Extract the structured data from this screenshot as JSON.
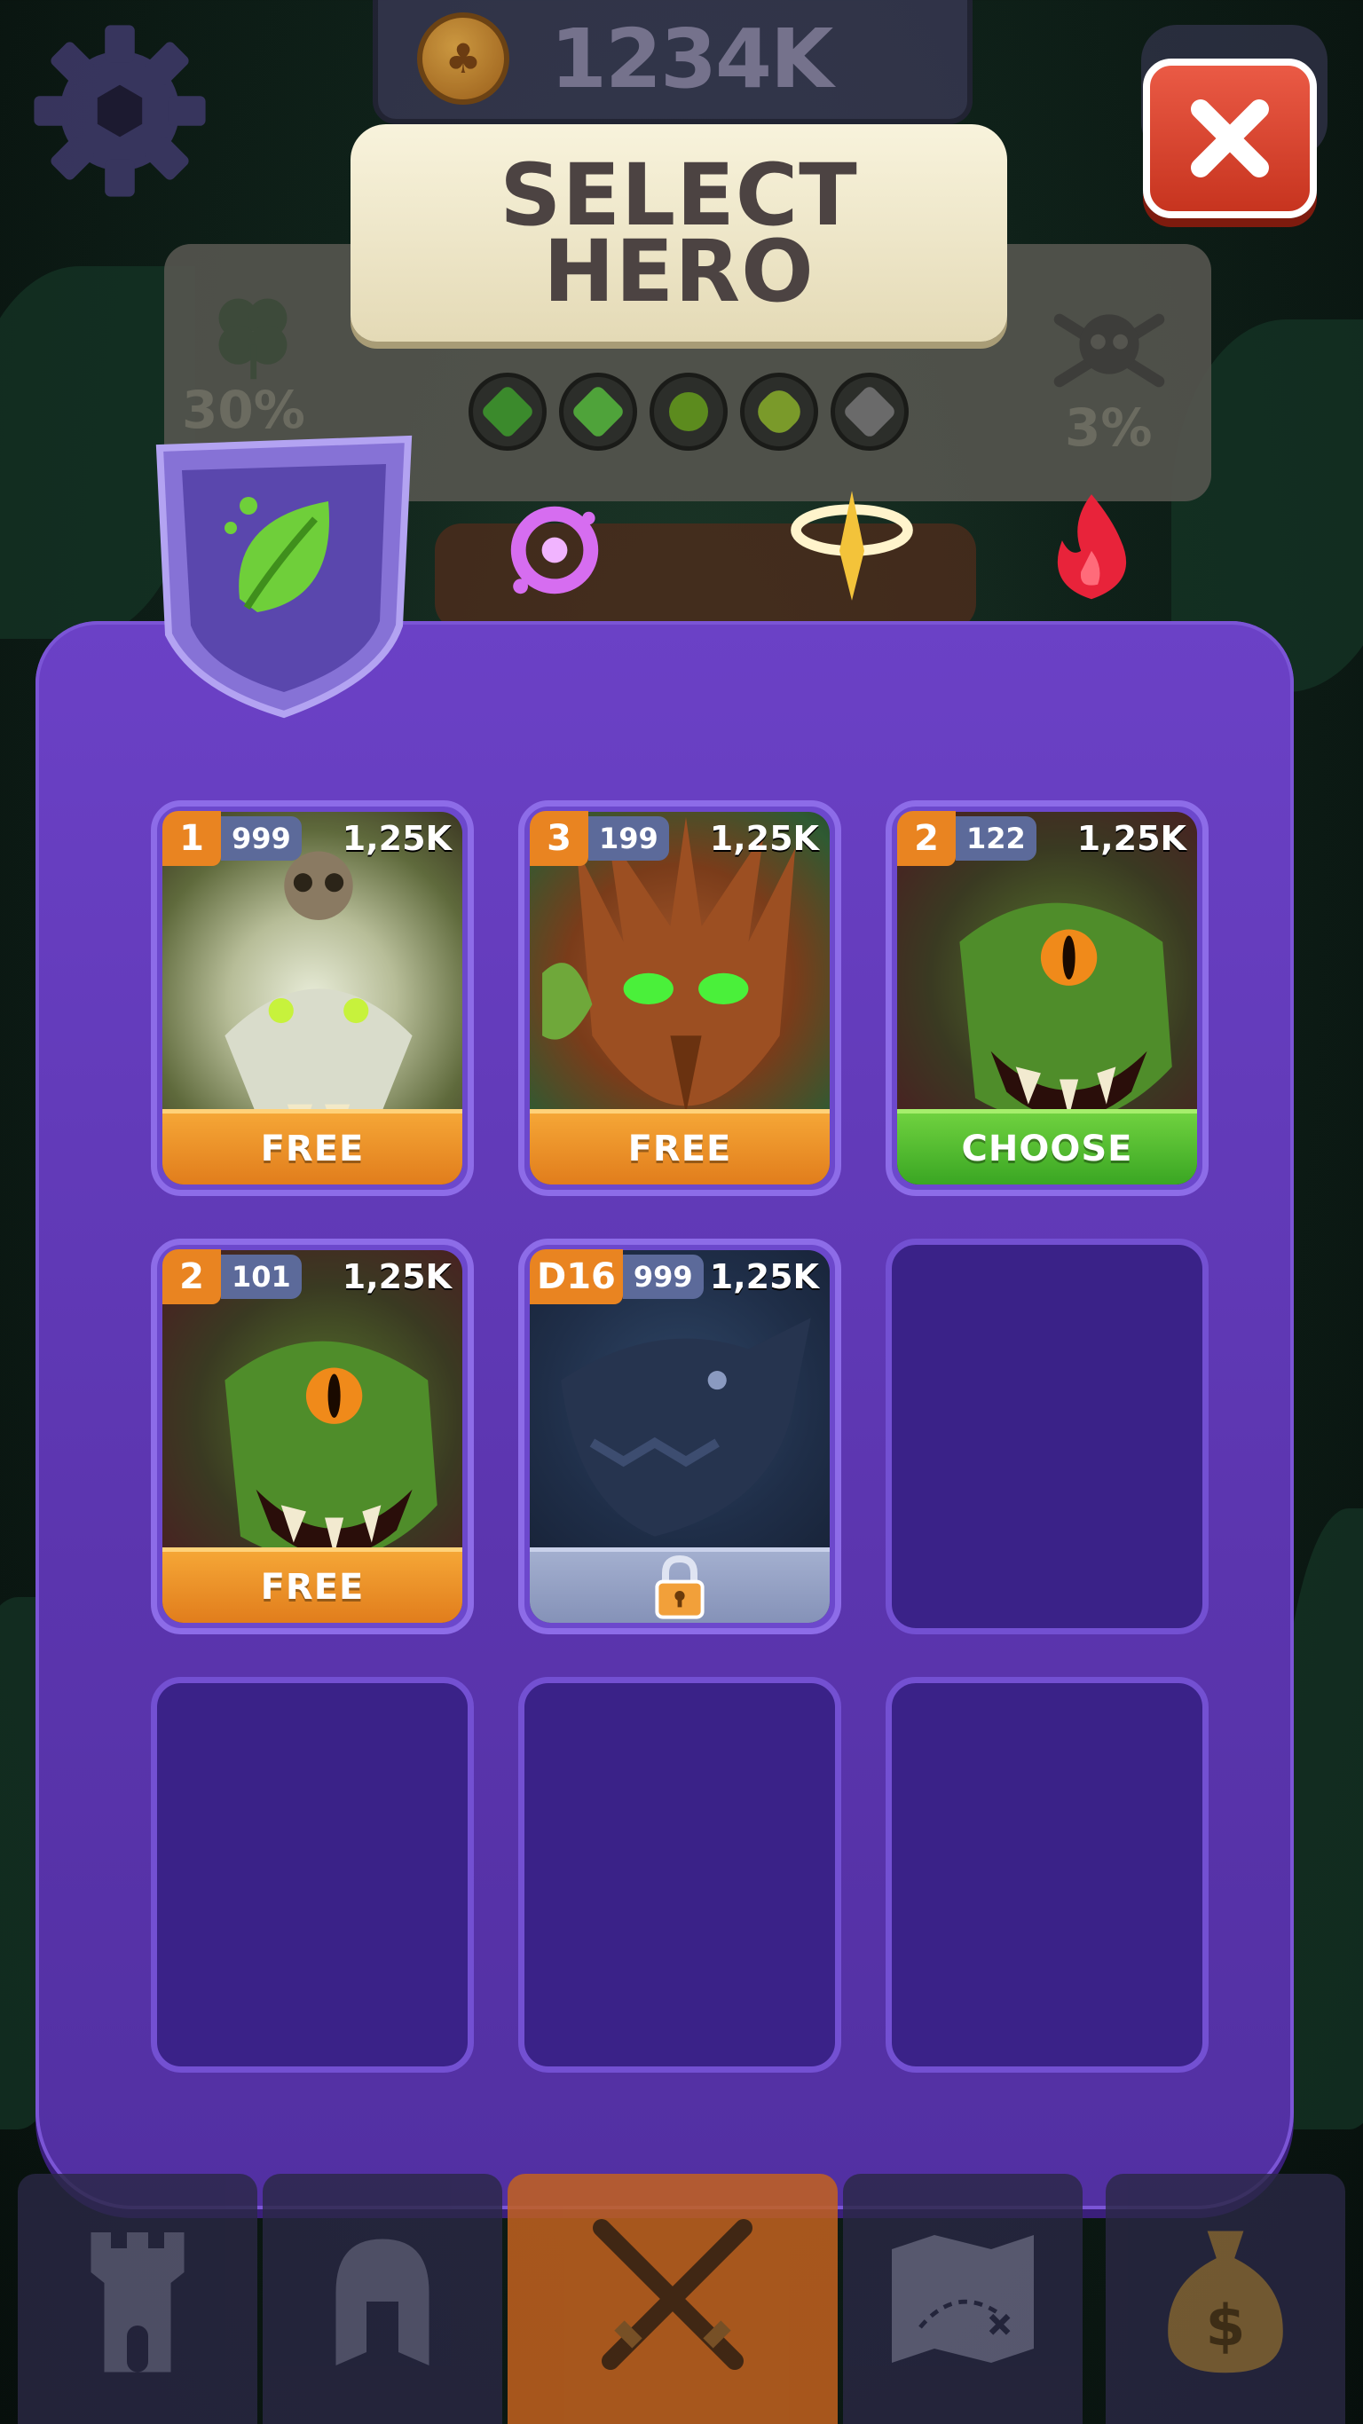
{
  "topbar": {
    "coins": "1234K"
  },
  "header": {
    "title_line1": "SELECT",
    "title_line2": "HERO"
  },
  "world": {
    "luck_percent": "30%",
    "death_percent": "3%",
    "gems": [
      {
        "icon": "green-crystal-icon",
        "color": "#3b8a2c"
      },
      {
        "icon": "green-shard-icon",
        "color": "#4fa33a"
      },
      {
        "icon": "potion-icon",
        "color": "#5c8b1e"
      },
      {
        "icon": "slime-icon",
        "color": "#7a9a2a"
      },
      {
        "icon": "rock-icon",
        "color": "#6a6a6a"
      }
    ]
  },
  "element_tabs": [
    {
      "name": "nature",
      "icon": "leaf-icon",
      "color": "#6fcf3a",
      "active": true
    },
    {
      "name": "arcane",
      "icon": "arcane-swirl-icon",
      "color": "#d66df0",
      "active": false
    },
    {
      "name": "light",
      "icon": "light-halo-icon",
      "color": "#f3c33a",
      "active": false
    },
    {
      "name": "fire",
      "icon": "flame-icon",
      "color": "#e8233a",
      "active": false
    }
  ],
  "heroes": [
    {
      "level": "1",
      "count": "999",
      "price": "1,25K",
      "action": "FREE",
      "state": "free",
      "portrait": "white-wolf"
    },
    {
      "level": "3",
      "count": "199",
      "price": "1,25K",
      "action": "FREE",
      "state": "free",
      "portrait": "treant"
    },
    {
      "level": "2",
      "count": "122",
      "price": "1,25K",
      "action": "CHOOSE",
      "state": "choose",
      "portrait": "goblin"
    },
    {
      "level": "2",
      "count": "101",
      "price": "1,25K",
      "action": "FREE",
      "state": "free",
      "portrait": "goblin"
    },
    {
      "level": "D16",
      "count": "999",
      "price": "1,25K",
      "action": "",
      "state": "locked",
      "portrait": "dark-dragon"
    }
  ],
  "empty_slots": 4,
  "bottom_nav": [
    {
      "name": "castle",
      "icon": "tower-icon",
      "active": false
    },
    {
      "name": "heroes",
      "icon": "helmet-icon",
      "active": false
    },
    {
      "name": "battle",
      "icon": "crossed-swords-icon",
      "active": true
    },
    {
      "name": "map",
      "icon": "treasure-map-icon",
      "active": false
    },
    {
      "name": "shop",
      "icon": "money-bag-icon",
      "active": false
    }
  ]
}
